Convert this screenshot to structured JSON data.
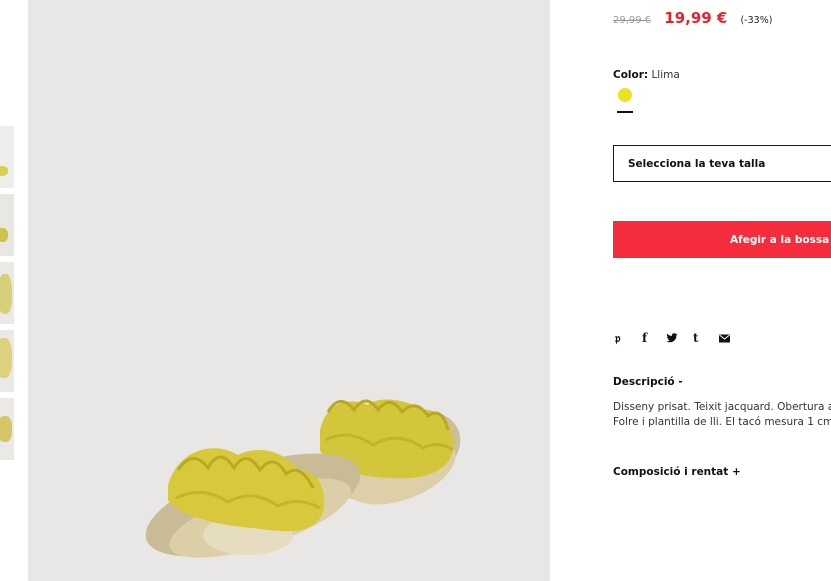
{
  "price": {
    "old": "29,99 €",
    "new": "19,99 €",
    "discount": "(-33%)"
  },
  "color": {
    "label": "Color:",
    "value": "Llima",
    "swatch_hex": "#ece123"
  },
  "size": {
    "placeholder": "Selecciona la teva talla"
  },
  "cart": {
    "add_label": "Afegir a la bossa"
  },
  "share": {
    "icons": [
      "pinterest-icon",
      "facebook-icon",
      "twitter-icon",
      "tumblr-icon",
      "email-icon"
    ]
  },
  "description": {
    "title": "Descripció  -",
    "line1": "Disseny prisat. Teixit jacquard. Obertura a",
    "line2": "Folre i plantilla de lli. El tacó mesura 1 cm."
  },
  "composition": {
    "title": "Composició i rentat  +"
  },
  "colors": {
    "sale_red": "#e8212e",
    "button_red": "#f52c3b",
    "image_bg": "#e8e7e5"
  }
}
